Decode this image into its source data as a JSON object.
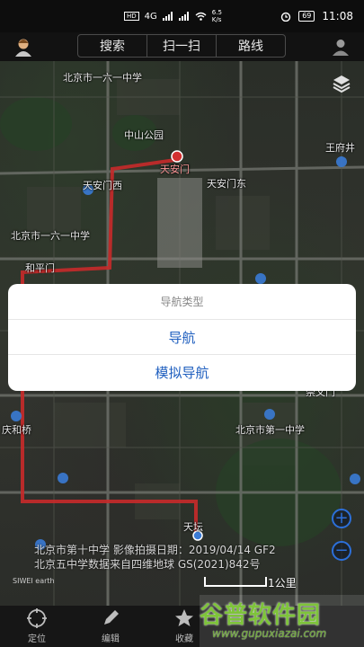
{
  "status": {
    "signal_left": "HD",
    "network": "4G",
    "speed": "6.5",
    "speed_unit": "K/s",
    "battery": "69",
    "time": "11:08"
  },
  "topbar": {
    "tabs": [
      {
        "label": "搜索"
      },
      {
        "label": "扫一扫"
      },
      {
        "label": "路线"
      }
    ]
  },
  "map": {
    "labels": [
      {
        "text": "北京市一六一中学"
      },
      {
        "text": "中山公园"
      },
      {
        "text": "天安门"
      },
      {
        "text": "天安门西"
      },
      {
        "text": "天安门东"
      },
      {
        "text": "北京市一六一中学"
      },
      {
        "text": "和平门"
      },
      {
        "text": "王府井"
      },
      {
        "text": "崇文门"
      },
      {
        "text": "北京市第一中学"
      },
      {
        "text": "天坛"
      },
      {
        "text": "庆和桥"
      }
    ],
    "credit_line1": "北京市第十中学  影像拍摄日期：2019/04/14 GF2",
    "credit_line2": "北京五中学数据来自四维地球 GS(2021)842号",
    "siwei": "SIWEI earth",
    "scale_label": "1公里"
  },
  "dialog": {
    "title": "导航类型",
    "option1": "导航",
    "option2": "模拟导航"
  },
  "bottombar": {
    "tabs": [
      {
        "label": "定位"
      },
      {
        "label": "编辑"
      },
      {
        "label": "收藏"
      }
    ]
  },
  "watermark": {
    "title": "谷普软件园",
    "url": "www.gupuxiazai.com"
  },
  "colors": {
    "route": "#c82a2a",
    "accent": "#1f5fbf",
    "watermark": "#7ec43a"
  }
}
